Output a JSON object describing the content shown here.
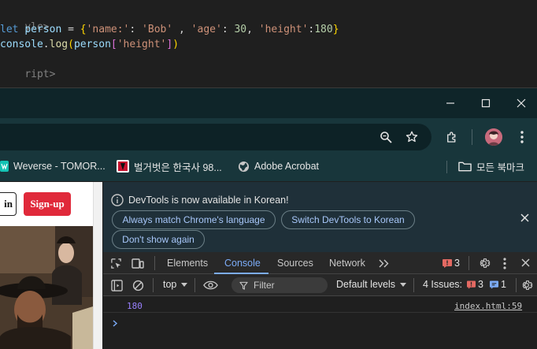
{
  "editor": {
    "line1": "yle>",
    "line2": {
      "kw": "let",
      "var": "person",
      "op": " = ",
      "open": "{",
      "k1": "'name:'",
      "v1": "'Bob'",
      "k2": "'age'",
      "v2": "30",
      "k3": "'height'",
      "v3": "180",
      "close": "}"
    },
    "line3": {
      "obj": "console",
      "fn": "log",
      "arg_var": "person",
      "arg_key": "'height'"
    },
    "line4": "ript>"
  },
  "bookmarks": [
    {
      "label": "Weverse - TOMOR...",
      "icon": "weverse-icon"
    },
    {
      "label": "벌거벗은 한국사 98...",
      "icon": "tv-logo-icon"
    },
    {
      "label": "Adobe Acrobat",
      "icon": "globe-icon"
    }
  ],
  "bookmarks_folder": "모든 북마크",
  "page": {
    "login_label": "in",
    "signup_label": "Sign-up"
  },
  "devtools": {
    "info_message": "DevTools is now available in Korean!",
    "btn_match_language": "Always match Chrome's language",
    "btn_switch_korean": "Switch DevTools to Korean",
    "btn_dont_show": "Don't show again",
    "tabs": [
      "Elements",
      "Console",
      "Sources",
      "Network"
    ],
    "active_tab": "Console",
    "issue_badge_count": "3",
    "context": "top",
    "filter_placeholder": "Filter",
    "levels": "Default levels",
    "issues_label": "4 Issues:",
    "issues_error_count": "3",
    "issues_info_count": "1",
    "log_value": "180",
    "log_source": "index.html:59"
  },
  "colors": {
    "accent": "#7cacf8",
    "signup": "#e0293a",
    "error_badge": "#e46962",
    "titlebar": "#0f2529"
  }
}
